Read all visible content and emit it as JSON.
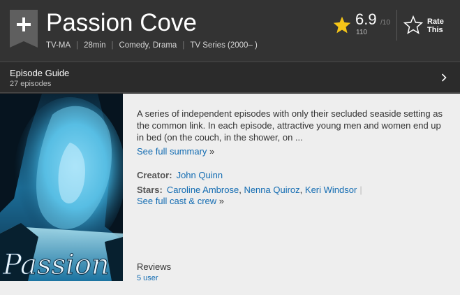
{
  "header": {
    "title": "Passion Cove",
    "rating_tag": "TV-MA",
    "runtime": "28min",
    "genres": "Comedy, Drama",
    "series_info": "TV Series (2000– )",
    "separator": "|"
  },
  "rating": {
    "value": "6.9",
    "max": "/10",
    "count": "110",
    "rate_label_line1": "Rate",
    "rate_label_line2": "This"
  },
  "episode_guide": {
    "title": "Episode Guide",
    "count": "27 episodes"
  },
  "poster": {
    "caption": "Passion"
  },
  "summary": {
    "text": "A series of independent episodes with only their secluded seaside setting as the common link. In each episode, attractive young men and women end up in bed (on the couch, in the shower, on ...",
    "see_full": "See full summary",
    "raquo": "»"
  },
  "credits": {
    "creator_label": "Creator:",
    "creator": "John Quinn",
    "stars_label": "Stars:",
    "stars": [
      "Caroline Ambrose",
      "Nenna Quiroz",
      "Keri Windsor"
    ],
    "comma": ",",
    "pipe": "|",
    "see_full_cast": "See full cast & crew",
    "raquo": "»"
  },
  "reviews": {
    "title": "Reviews",
    "user": "5 user"
  },
  "colors": {
    "header_bg": "#333333",
    "link": "#136cb2",
    "star": "#f5c518",
    "content_bg": "#eeeeee"
  },
  "icons": {
    "watchlist": "plus-ribbon-icon",
    "rating": "star-filled-icon",
    "rate": "star-outline-icon",
    "next": "chevron-right-icon"
  }
}
